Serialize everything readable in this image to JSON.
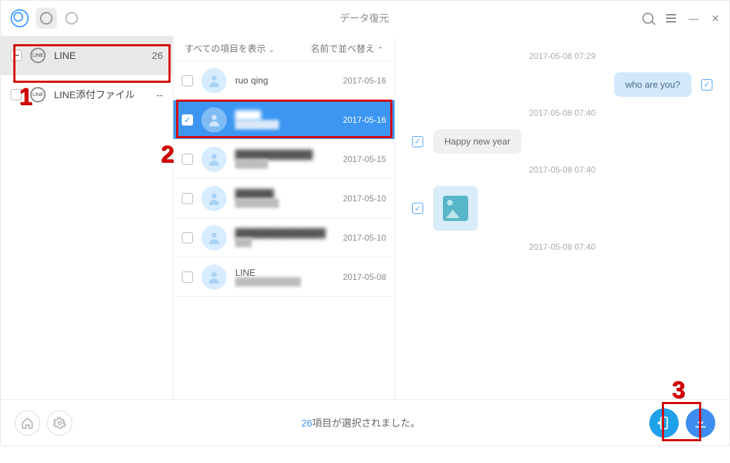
{
  "header": {
    "title": "データ復元"
  },
  "sidebar": {
    "items": [
      {
        "icon": "LINE",
        "label": "LINE",
        "count": "26",
        "chk": "minus",
        "selected": true
      },
      {
        "icon": "LINE",
        "label": "LINE添付ファイル",
        "count": "--",
        "chk": "empty",
        "selected": false
      }
    ]
  },
  "listHeader": {
    "left": "すべての項目を表示",
    "right": "名前で並べ替え"
  },
  "list": [
    {
      "name": "ruo qing",
      "sub": "",
      "date": "2017-05-16",
      "checked": false,
      "selected": false,
      "blur": false
    },
    {
      "name": "████",
      "sub": "████████",
      "date": "2017-05-16",
      "checked": true,
      "selected": true,
      "blur": true
    },
    {
      "name": "████████████",
      "sub": "██████",
      "date": "2017-05-15",
      "checked": false,
      "selected": false,
      "blur": true
    },
    {
      "name": "██████",
      "sub": "████████",
      "date": "2017-05-10",
      "checked": false,
      "selected": false,
      "blur": true
    },
    {
      "name": "██████████████",
      "sub": "███",
      "date": "2017-05-10",
      "checked": false,
      "selected": false,
      "blur": true
    },
    {
      "name": "LINE",
      "sub": "████████████",
      "date": "2017-05-08",
      "checked": false,
      "selected": false,
      "blur": false
    }
  ],
  "chat": {
    "ts1": "2017-05-08 07:29",
    "m1": "who are you?",
    "ts2": "2017-05-08 07:40",
    "m2": "Happy new year",
    "ts3": "2017-05-08 07:40",
    "ts4": "2017-05-08 07:40"
  },
  "footer": {
    "count": "26",
    "suffix": "項目が選択されました。"
  },
  "annotations": {
    "n1": "1",
    "n2": "2",
    "n3": "3"
  }
}
